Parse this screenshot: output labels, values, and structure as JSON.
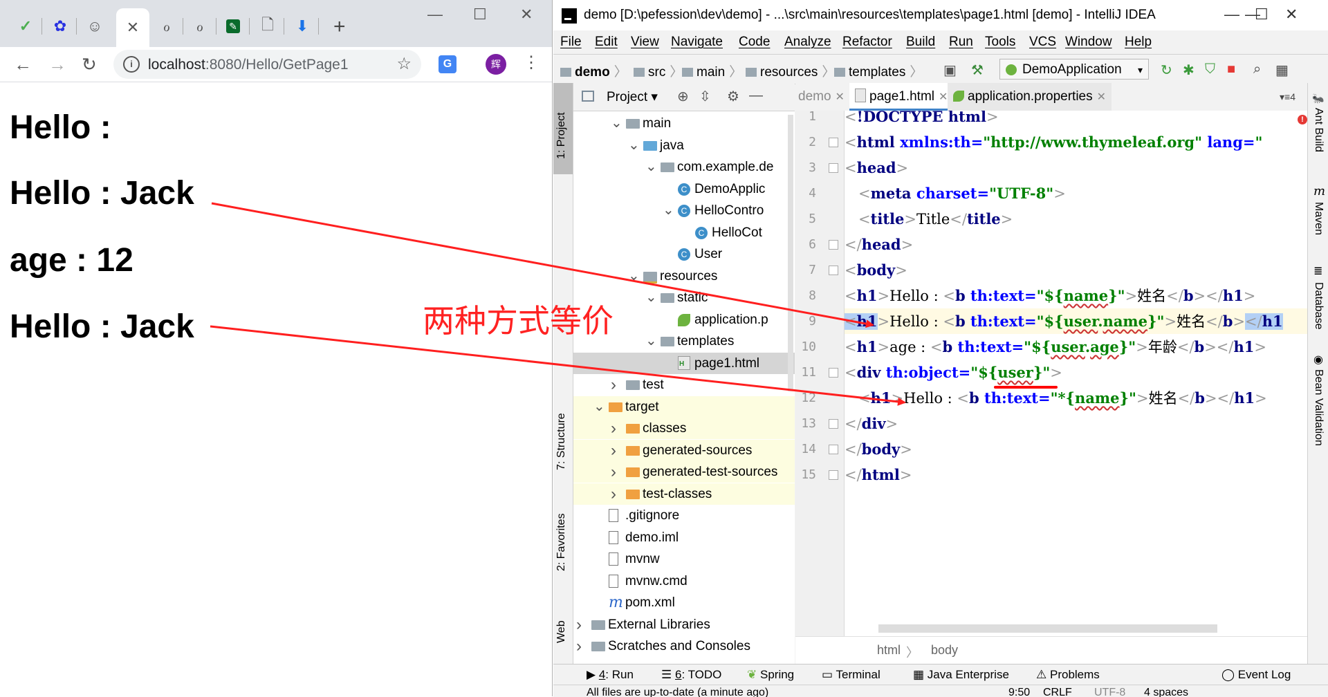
{
  "browser": {
    "url_host": "localhost",
    "url_path": ":8080/Hello/GetPage1",
    "translate_icon": "G",
    "avatar_text": "辉",
    "tab_close": "✕",
    "new_tab": "+",
    "page_lines": [
      "Hello :",
      "Hello : Jack",
      "age : 12",
      "Hello : Jack"
    ]
  },
  "ide": {
    "window_title": "demo [D:\\pefession\\dev\\demo] - ...\\src\\main\\resources\\templates\\page1.html [demo] - IntelliJ IDEA",
    "menu": [
      "File",
      "Edit",
      "View",
      "Navigate",
      "Code",
      "Analyze",
      "Refactor",
      "Build",
      "Run",
      "Tools",
      "VCS",
      "Window",
      "Help"
    ],
    "breadcrumbs": [
      "demo",
      "src",
      "main",
      "resources",
      "templates"
    ],
    "run_config": "DemoApplication",
    "project_label": "Project",
    "left_stripe": [
      "1: Project",
      "7: Structure",
      "2: Favorites",
      "Web"
    ],
    "right_stripe": [
      "Ant Build",
      "Maven",
      "Database",
      "Bean Validation"
    ],
    "tree": [
      {
        "label": "main",
        "depth": 2,
        "arrow": "v",
        "icon": "folder"
      },
      {
        "label": "java",
        "depth": 3,
        "arrow": "v",
        "icon": "folder-blue"
      },
      {
        "label": "com.example.de",
        "depth": 4,
        "arrow": "v",
        "icon": "package"
      },
      {
        "label": "DemoApplic",
        "depth": 5,
        "arrow": "",
        "icon": "spring-class"
      },
      {
        "label": "HelloContro",
        "depth": 5,
        "arrow": "v",
        "icon": "class"
      },
      {
        "label": "HelloCot",
        "depth": 6,
        "arrow": "",
        "icon": "class"
      },
      {
        "label": "User",
        "depth": 5,
        "arrow": "",
        "icon": "class"
      },
      {
        "label": "resources",
        "depth": 3,
        "arrow": "v",
        "icon": "folder-res"
      },
      {
        "label": "static",
        "depth": 4,
        "arrow": "v",
        "icon": "folder"
      },
      {
        "label": "application.p",
        "depth": 5,
        "arrow": "",
        "icon": "spring-leaf"
      },
      {
        "label": "templates",
        "depth": 4,
        "arrow": "v",
        "icon": "folder"
      },
      {
        "label": "page1.html",
        "depth": 5,
        "arrow": "",
        "icon": "html"
      },
      {
        "label": "test",
        "depth": 2,
        "arrow": ">",
        "icon": "folder"
      },
      {
        "label": "target",
        "depth": 1,
        "arrow": "v",
        "icon": "folder-orange"
      },
      {
        "label": "classes",
        "depth": 2,
        "arrow": ">",
        "icon": "folder-orange"
      },
      {
        "label": "generated-sources",
        "depth": 2,
        "arrow": ">",
        "icon": "folder-orange"
      },
      {
        "label": "generated-test-sources",
        "depth": 2,
        "arrow": ">",
        "icon": "folder-orange"
      },
      {
        "label": "test-classes",
        "depth": 2,
        "arrow": ">",
        "icon": "folder-orange"
      },
      {
        "label": ".gitignore",
        "depth": 1,
        "arrow": "",
        "icon": "file"
      },
      {
        "label": "demo.iml",
        "depth": 1,
        "arrow": "",
        "icon": "file"
      },
      {
        "label": "mvnw",
        "depth": 1,
        "arrow": "",
        "icon": "file"
      },
      {
        "label": "mvnw.cmd",
        "depth": 1,
        "arrow": "",
        "icon": "file"
      },
      {
        "label": "pom.xml",
        "depth": 1,
        "arrow": "",
        "icon": "maven"
      },
      {
        "label": "External Libraries",
        "depth": 0,
        "arrow": ">",
        "icon": "library"
      },
      {
        "label": "Scratches and Consoles",
        "depth": 0,
        "arrow": ">",
        "icon": "scratch"
      }
    ],
    "editor_tabs": [
      "demo",
      "page1.html",
      "application.properties"
    ],
    "tab_count_label": "4",
    "line_numbers": [
      "1",
      "2",
      "3",
      "4",
      "5",
      "6",
      "7",
      "8",
      "9",
      "10",
      "11",
      "12",
      "13",
      "14",
      "15"
    ],
    "code_breadcrumb": [
      "html",
      "body"
    ],
    "tool_windows": [
      {
        "key": "4",
        "label": ": Run"
      },
      {
        "key": "6",
        "label": ": TODO"
      },
      {
        "key": "",
        "label": "Spring"
      },
      {
        "key": "",
        "label": "Terminal"
      },
      {
        "key": "",
        "label": "Java Enterprise"
      },
      {
        "key": "",
        "label": "Problems"
      },
      {
        "key": "",
        "label": "Event Log"
      }
    ],
    "status": {
      "message": "All files are up-to-date (a minute ago)",
      "position": "9:50",
      "line_sep": "CRLF",
      "encoding": "UTF-8",
      "indent": "4 spaces"
    }
  },
  "annotation": {
    "text": "两种方式等价",
    "color": "#ff2222"
  }
}
